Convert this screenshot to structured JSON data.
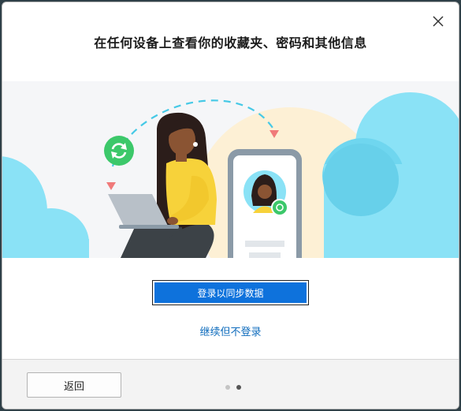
{
  "dialog": {
    "title": "在任何设备上查看你的收藏夹、密码和其他信息",
    "close_icon": "close-icon",
    "primary_button_label": "登录以同步数据",
    "secondary_link_label": "继续但不登录",
    "back_button_label": "返回",
    "pagination": {
      "total": 2,
      "current": 2
    }
  },
  "colors": {
    "accent": "#0e72dc",
    "link": "#0f6cbd",
    "cloud": "#8ae2f6",
    "sync_badge": "#3cc86a",
    "shirt": "#f7d23a",
    "dot_inactive": "#c4c4c4",
    "dot_active": "#555555"
  }
}
